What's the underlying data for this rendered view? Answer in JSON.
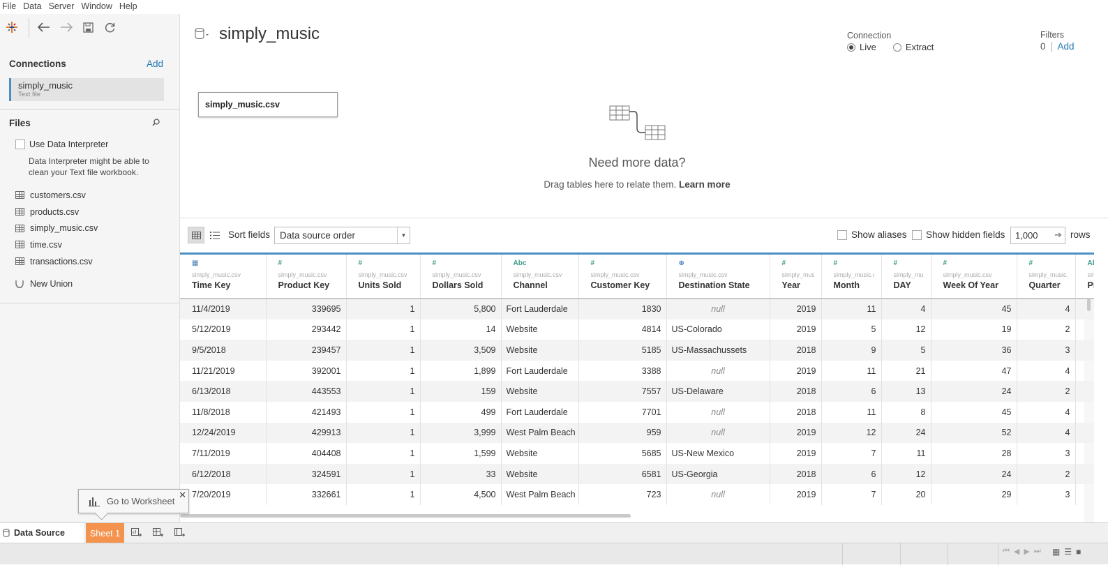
{
  "menu": [
    "File",
    "Data",
    "Server",
    "Window",
    "Help"
  ],
  "sidebar": {
    "connections_title": "Connections",
    "add_label": "Add",
    "connection": {
      "name": "simply_music",
      "type": "Text file"
    },
    "files_title": "Files",
    "use_interpreter": "Use Data Interpreter",
    "interpreter_note": "Data Interpreter might be able to clean your Text file workbook.",
    "files": [
      "customers.csv",
      "products.csv",
      "simply_music.csv",
      "time.csv",
      "transactions.csv"
    ],
    "new_union": "New Union"
  },
  "canvas": {
    "datasource_name": "simply_music",
    "connection_label": "Connection",
    "live": "Live",
    "extract": "Extract",
    "filters_label": "Filters",
    "filters_count": "0",
    "filters_add": "Add",
    "table_name": "simply_music.csv",
    "need_more_title": "Need more data?",
    "need_more_text": "Drag tables here to relate them.",
    "learn_more": "Learn more"
  },
  "gridbar": {
    "sort_label": "Sort fields",
    "sort_value": "Data source order",
    "show_aliases": "Show aliases",
    "show_hidden": "Show hidden fields",
    "rows_value": "1,000",
    "rows_label": "rows"
  },
  "grid": {
    "columns": [
      {
        "icon": "date",
        "type_glyph": "▦",
        "source": "simply_music.csv",
        "name": "Time Key"
      },
      {
        "icon": "number",
        "type_glyph": "#",
        "source": "simply_music.csv",
        "name": "Product Key"
      },
      {
        "icon": "number",
        "type_glyph": "#",
        "source": "simply_music.csv",
        "name": "Units Sold"
      },
      {
        "icon": "number",
        "type_glyph": "#",
        "source": "simply_music.csv",
        "name": "Dollars Sold"
      },
      {
        "icon": "string",
        "type_glyph": "Abc",
        "source": "simply_music.csv",
        "name": "Channel"
      },
      {
        "icon": "number",
        "type_glyph": "#",
        "source": "simply_music.csv",
        "name": "Customer Key"
      },
      {
        "icon": "geo",
        "type_glyph": "⊕",
        "source": "simply_music.csv",
        "name": "Destination State"
      },
      {
        "icon": "number",
        "type_glyph": "#",
        "source": "simply_musi...",
        "name": "Year"
      },
      {
        "icon": "number",
        "type_glyph": "#",
        "source": "simply_music.c...",
        "name": "Month"
      },
      {
        "icon": "number",
        "type_glyph": "#",
        "source": "simply_mus...",
        "name": "DAY"
      },
      {
        "icon": "number",
        "type_glyph": "#",
        "source": "simply_music.csv",
        "name": "Week Of Year"
      },
      {
        "icon": "number",
        "type_glyph": "#",
        "source": "simply_music.csv",
        "name": "Quarter"
      },
      {
        "icon": "string",
        "type_glyph": "Ab",
        "source": "sir",
        "name": "Pr"
      }
    ],
    "rows": [
      [
        "11/4/2019",
        "339695",
        "1",
        "5,800",
        "Fort Lauderdale",
        "1830",
        "null",
        "2019",
        "11",
        "4",
        "45",
        "4",
        ""
      ],
      [
        "5/12/2019",
        "293442",
        "1",
        "14",
        "Website",
        "4814",
        "US-Colorado",
        "2019",
        "5",
        "12",
        "19",
        "2",
        ""
      ],
      [
        "9/5/2018",
        "239457",
        "1",
        "3,509",
        "Website",
        "5185",
        "US-Massachussets",
        "2018",
        "9",
        "5",
        "36",
        "3",
        ""
      ],
      [
        "11/21/2019",
        "392001",
        "1",
        "1,899",
        "Fort Lauderdale",
        "3388",
        "null",
        "2019",
        "11",
        "21",
        "47",
        "4",
        ""
      ],
      [
        "6/13/2018",
        "443553",
        "1",
        "159",
        "Website",
        "7557",
        "US-Delaware",
        "2018",
        "6",
        "13",
        "24",
        "2",
        ""
      ],
      [
        "11/8/2018",
        "421493",
        "1",
        "499",
        "Fort Lauderdale",
        "7701",
        "null",
        "2018",
        "11",
        "8",
        "45",
        "4",
        ""
      ],
      [
        "12/24/2019",
        "429913",
        "1",
        "3,999",
        "West Palm Beach",
        "959",
        "null",
        "2019",
        "12",
        "24",
        "52",
        "4",
        ""
      ],
      [
        "7/11/2019",
        "404408",
        "1",
        "1,599",
        "Website",
        "5685",
        "US-New Mexico",
        "2019",
        "7",
        "11",
        "28",
        "3",
        ""
      ],
      [
        "6/12/2018",
        "324591",
        "1",
        "33",
        "Website",
        "6581",
        "US-Georgia",
        "2018",
        "6",
        "12",
        "24",
        "2",
        ""
      ],
      [
        "7/20/2019",
        "332661",
        "1",
        "4,500",
        "West Palm Beach",
        "723",
        "null",
        "2019",
        "7",
        "20",
        "29",
        "3",
        ""
      ]
    ]
  },
  "tabs": {
    "data_source": "Data Source",
    "sheet": "Sheet 1"
  },
  "tooltip": {
    "text": "Go to Worksheet"
  }
}
